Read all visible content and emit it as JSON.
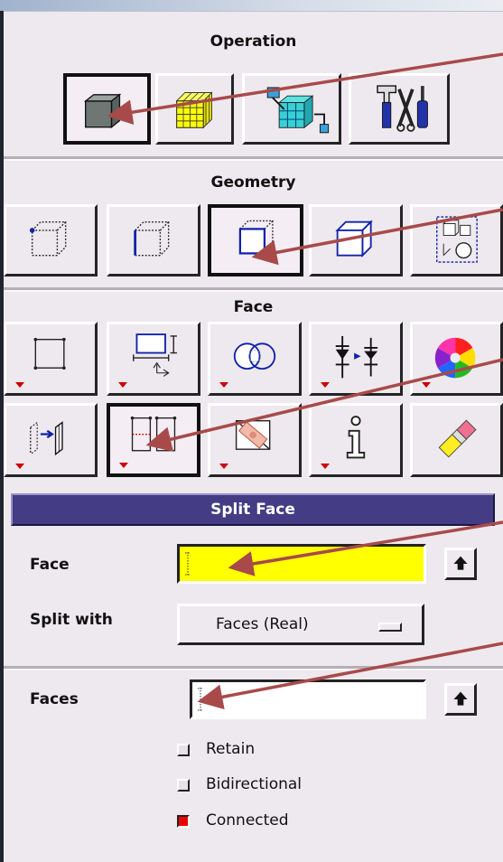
{
  "sections": {
    "operation": {
      "title": "Operation",
      "buttons": [
        {
          "icon": "geometry-cube-icon",
          "active": true
        },
        {
          "icon": "mesh-cube-icon",
          "active": false
        },
        {
          "icon": "zones-icon",
          "active": false
        },
        {
          "icon": "tools-icon",
          "active": false
        }
      ]
    },
    "geometry": {
      "title": "Geometry",
      "buttons": [
        {
          "icon": "vertex-icon",
          "active": false
        },
        {
          "icon": "edge-icon",
          "active": false
        },
        {
          "icon": "face-icon",
          "active": true
        },
        {
          "icon": "volume-icon",
          "active": false
        },
        {
          "icon": "group-icon",
          "active": false
        }
      ]
    },
    "face": {
      "title": "Face",
      "buttons_row1": [
        {
          "icon": "create-face-icon"
        },
        {
          "icon": "move-face-icon"
        },
        {
          "icon": "boolean-face-icon"
        },
        {
          "icon": "merge-faces-icon"
        },
        {
          "icon": "color-wheel-icon"
        }
      ],
      "buttons_row2": [
        {
          "icon": "connect-faces-icon"
        },
        {
          "icon": "split-face-icon",
          "active": true
        },
        {
          "icon": "delete-face-icon"
        },
        {
          "icon": "info-icon"
        },
        {
          "icon": "eraser-icon"
        }
      ]
    }
  },
  "panel": {
    "title": "Split Face",
    "face_label": "Face",
    "face_value": "",
    "split_with_label": "Split with",
    "split_with_value": "Faces (Real)",
    "faces_label": "Faces",
    "faces_value": "",
    "options": [
      {
        "label": "Retain",
        "checked": false
      },
      {
        "label": "Bidirectional",
        "checked": false
      },
      {
        "label": "Connected",
        "checked": true
      }
    ]
  },
  "colors": {
    "banner": "#443c84",
    "face_field": "#ffff00",
    "arrow": "#a84a4a",
    "indicator": "#cc0000"
  }
}
